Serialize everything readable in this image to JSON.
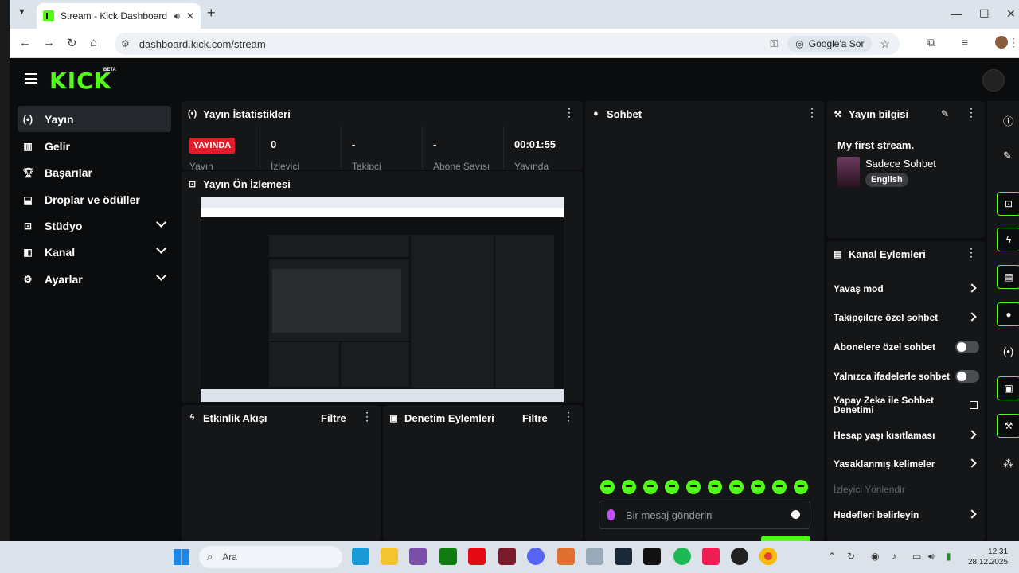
{
  "browser": {
    "tab_title": "Stream - Kick Dashboard",
    "url": "dashboard.kick.com/stream",
    "google_ask": "Google'a Sor"
  },
  "header": {
    "logo": "KICK",
    "beta": "BETA"
  },
  "sidebar": {
    "items": [
      {
        "label": "Yayın",
        "icon": "broadcast-icon",
        "active": true
      },
      {
        "label": "Gelir",
        "icon": "chart-icon"
      },
      {
        "label": "Başarılar",
        "icon": "trophy-icon"
      },
      {
        "label": "Droplar ve ödüller",
        "icon": "drops-icon"
      },
      {
        "label": "Stüdyo",
        "icon": "studio-icon",
        "expandable": true
      },
      {
        "label": "Kanal",
        "icon": "channel-icon",
        "expandable": true
      },
      {
        "label": "Ayarlar",
        "icon": "gear-icon",
        "expandable": true
      }
    ]
  },
  "stats": {
    "title": "Yayın İstatistikleri",
    "live_badge": "YAYINDA",
    "live_label": "Yayın",
    "viewers_value": "0",
    "viewers_label": "İzleyici",
    "followers_value": "-",
    "followers_label": "Takipçi",
    "subs_value": "-",
    "subs_label": "Abone Sayısı",
    "duration_value": "00:01:55",
    "duration_label": "Yayında"
  },
  "preview": {
    "title": "Yayın Ön İzlemesi"
  },
  "activity": {
    "title": "Etkinlik Akışı",
    "filter": "Filtre"
  },
  "moderation": {
    "title": "Denetim Eylemleri",
    "filter": "Filtre"
  },
  "chat": {
    "title": "Sohbet",
    "placeholder": "Bir mesaj gönderin"
  },
  "stream_info": {
    "title": "Yayın bilgisi",
    "stream_title": "My first stream.",
    "category": "Sadece Sohbet",
    "language": "English"
  },
  "channel_actions": {
    "title": "Kanal Eylemleri",
    "slow_mode": "Yavaş mod",
    "followers_only": "Takipçilere özel sohbet",
    "subs_only": "Abonelere özel sohbet",
    "emotes_only": "Yalnızca ifadelerle sohbet",
    "ai_moderation": "Yapay Zeka ile Sohbet Denetimi",
    "account_age": "Hesap yaşı kısıtlaması",
    "banned_words": "Yasaklanmış kelimeler",
    "redirect_viewers": "İzleyici Yönlendir",
    "goals": "Hedefleri belirleyin"
  },
  "taskbar": {
    "search": "Ara",
    "time": "12:31",
    "date": "28.12.2025"
  }
}
